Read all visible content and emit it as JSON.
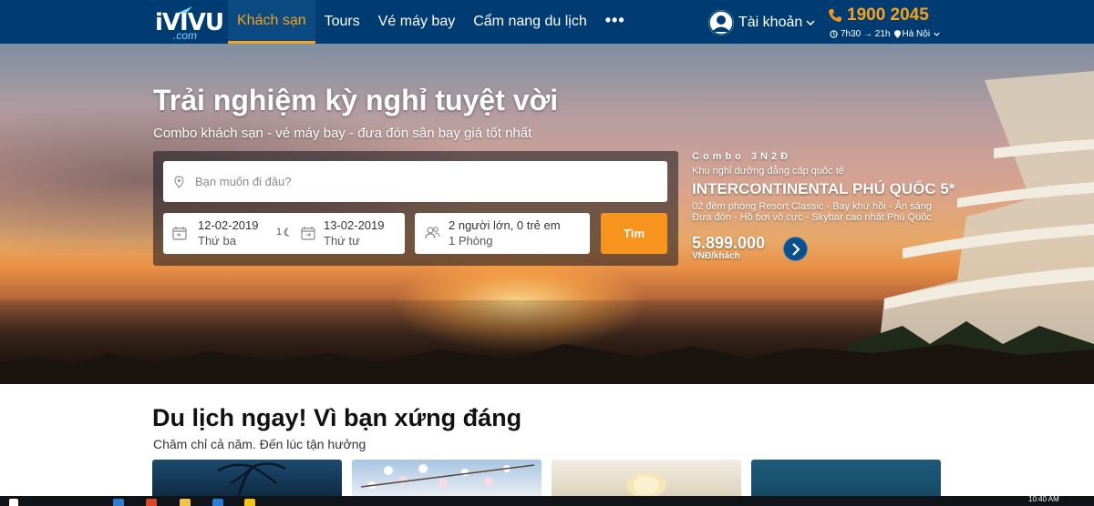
{
  "header": {
    "logo_text": "iVIVU",
    "logo_sub": ".com",
    "nav": [
      "Khách sạn",
      "Tours",
      "Vé máy bay",
      "Cẩm nang du lịch"
    ],
    "more": "•••",
    "account_label": "Tài khoản",
    "hotline": "1900 2045",
    "hours": "7h30 → 21h",
    "location": "Hà Nội"
  },
  "hero": {
    "title": "Trải nghiệm kỳ nghỉ tuyệt vời",
    "subtitle": "Combo khách sạn - vé máy bay - đưa đón sân bay giá tốt nhất",
    "search": {
      "destination_placeholder": "Bạn muốn đi đâu?",
      "checkin_date": "12-02-2019",
      "checkin_day": "Thứ ba",
      "nights": "1",
      "checkout_date": "13-02-2019",
      "checkout_day": "Thứ tư",
      "guests": "2 người lớn, 0 trẻ em",
      "rooms": "1 Phòng",
      "button": "Tìm"
    },
    "promo": {
      "tag": "Combo 3N2Đ",
      "desc": "Khu nghỉ dưỡng đẳng cấp quốc tế",
      "name": "INTERCONTINENTAL PHÚ QUỐC 5*",
      "line1": "02 đêm phòng Resort Classic - Bay khứ hồi - Ăn sáng",
      "line2": "Đưa đón - Hồ bơi vô cực - Skybar cao nhất Phú Quốc",
      "price": "5.899.000",
      "unit": "VNĐ/khách"
    }
  },
  "section": {
    "title": "Du lịch ngay! Vì bạn xứng đáng",
    "subtitle": "Chăm chỉ cả năm. Đến lúc tận hưởng"
  },
  "taskbar": {
    "time": "10:40 AM"
  },
  "colors": {
    "header_bg": "#003c71",
    "accent": "#f7941e",
    "promo_button": "#0b4f8c"
  }
}
